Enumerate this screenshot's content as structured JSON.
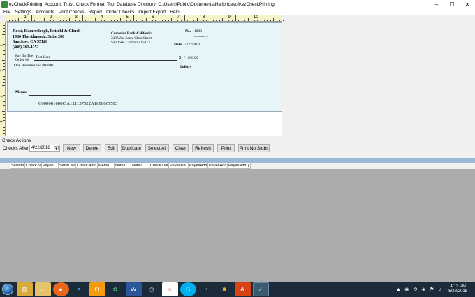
{
  "window": {
    "title": "ezCheckPrinting, Account: Trust, Check Format: Top, Database Directory: C:\\Users\\Public\\Documents\\Halfpricesoft\\ezCheckPrinting",
    "minimize": "‒",
    "maximize": "☐",
    "close": "✕"
  },
  "menu": [
    "File",
    "Settings",
    "Accounts",
    "Print Checks",
    "Report",
    "Order Checks",
    "Import/Export",
    "Help"
  ],
  "ruler": {
    "top_numbers": [
      "1",
      "2",
      "3",
      "4",
      "5",
      "6",
      "7",
      "8",
      "9",
      "10"
    ],
    "left_numbers": [
      "1",
      "2",
      "3",
      "4"
    ]
  },
  "check": {
    "company": {
      "name": "Rossi, Hamersleogh, Reischl & Chuck",
      "address1": "1960 The Alameda, Suite 200",
      "address2": "San Jose, CA 95126",
      "phone": "(408) 261-4252"
    },
    "bank": {
      "name": "Comerica Bank-California",
      "address1": "333 West Santa Clara Street",
      "address2": "San Jose, California 95113"
    },
    "no_label": "No.",
    "number": "1000",
    "fraction": "90-4030/1210",
    "date_label": "Date",
    "date": "5/22/2018",
    "pay_to_label_1": "Pay To The",
    "pay_to_label_2": "Order Of",
    "payee": "Test User",
    "dollar_sign": "$",
    "amount": "**100.00",
    "amount_words": "One Hundred and 00/100",
    "dollars_label": "Dollars",
    "memo_label": "Memo:",
    "micr": "C000001000C A121137522A1890667593"
  },
  "actions": {
    "title": "Check Actions",
    "checks_after_label": "Checks After:",
    "checks_after_value": "4/22/2018",
    "buttons": [
      "New",
      "Delete",
      "Edit",
      "Duplicate",
      "Select All",
      "Clear",
      "Refresh",
      "Print",
      "Print No Stubs"
    ]
  },
  "grid": {
    "columns": [
      "Selecte",
      "Check N",
      "Payee",
      "Serial Nu",
      "Check Amo",
      "Memo",
      "Note1",
      "Note2",
      "Check Dat",
      "PayeeNa",
      "PayeeAdd",
      "PayeeAdd",
      "PayeeAdd",
      "["
    ]
  },
  "taskbar": {
    "apps": [
      "file-explorer",
      "folder",
      "firefox",
      "internet-explorer",
      "outlook",
      "snipping-tool",
      "word",
      "clock-app",
      "acrobat",
      "skype",
      "clock-app-2",
      "media-tool",
      "adobe-app",
      "ezcheckprinting"
    ],
    "clock_time": "4:13 PM",
    "clock_date": "5/22/2018"
  },
  "colors": {
    "check_background": "#e6f5f8",
    "ruler": "#f6f3c8",
    "grid_strip": "#9bbad6",
    "grid_body": "#acacac",
    "taskbar": "#1b2b3a"
  }
}
